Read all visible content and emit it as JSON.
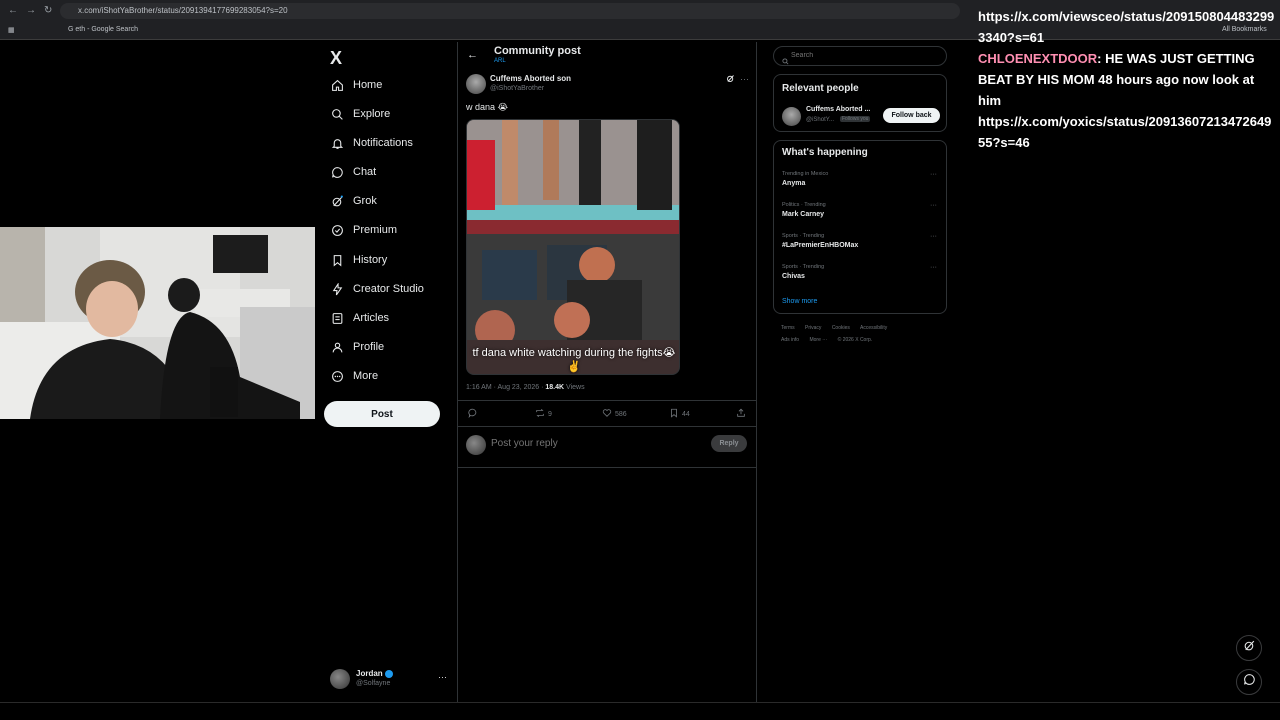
{
  "browser": {
    "url": "x.com/iShotYaBrother/status/2091394177699283054?s=20",
    "bookmark": "eth - Google Search",
    "all_bookmarks": "All Bookmarks"
  },
  "nav": {
    "logo": "X",
    "items": [
      {
        "label": "Home",
        "icon": "home-icon"
      },
      {
        "label": "Explore",
        "icon": "search-icon"
      },
      {
        "label": "Notifications",
        "icon": "bell-icon"
      },
      {
        "label": "Chat",
        "icon": "chat-icon"
      },
      {
        "label": "Grok",
        "icon": "grok-icon"
      },
      {
        "label": "Premium",
        "icon": "premium-icon"
      },
      {
        "label": "History",
        "icon": "bookmark-icon"
      },
      {
        "label": "Creator Studio",
        "icon": "lightning-icon"
      },
      {
        "label": "Articles",
        "icon": "articles-icon"
      },
      {
        "label": "Profile",
        "icon": "person-icon"
      },
      {
        "label": "More",
        "icon": "more-circle-icon"
      }
    ],
    "post_button": "Post",
    "account": {
      "name": "Jordan",
      "handle": "@Solfayne",
      "more": "···"
    }
  },
  "post": {
    "header_title": "Community post",
    "header_sub": "ARL",
    "author_name": "Cuffems Aborted son",
    "author_handle": "@iShotYaBrother",
    "text": "w dana 😭",
    "media_caption": "tf dana white watching during the fights😭✌️",
    "time": "1:16 AM · Aug 23, 2026 · ",
    "views_count": "18.4K",
    "views_label": " Views",
    "stats": {
      "replies": "",
      "reposts": "9",
      "likes": "586",
      "bookmarks": "44"
    },
    "reply_placeholder": "Post your reply",
    "reply_button": "Reply"
  },
  "sidebar": {
    "search_placeholder": "Search",
    "relevant_title": "Relevant people",
    "relevant_person": {
      "name": "Cuffems Aborted ...",
      "handle": "@iShotY...",
      "follows_you": "Follows you",
      "follow_button": "Follow back"
    },
    "happening_title": "What's happening",
    "trends": [
      {
        "context": "Trending in Mexico",
        "name": "Anyma"
      },
      {
        "context": "Politics · Trending",
        "name": "Mark Carney"
      },
      {
        "context": "Sports · Trending",
        "name": "#LaPremierEnHBOMax"
      },
      {
        "context": "Sports · Trending",
        "name": "Chivas"
      }
    ],
    "show_more": "Show more",
    "footer_row1": [
      "Terms",
      "Privacy",
      "Cookies",
      "Accessibility"
    ],
    "footer_row2": [
      "Ads info",
      "More ···",
      "© 2026 X Corp."
    ]
  },
  "overlay": {
    "link1": "https://x.com/viewsceo/status/2091508044832993340?s=61",
    "username": "CHLOENEXTDOOR",
    "message": ":  HE WAS JUST GETTING BEAT BY HIS MOM 48 hours ago now look at him",
    "link2": "https://x.com/yoxics/status/2091360721347264955?s=46"
  },
  "colors": {
    "accent": "#1d9bf0",
    "background": "#000000",
    "overlay_user": "#ff8fb2"
  }
}
